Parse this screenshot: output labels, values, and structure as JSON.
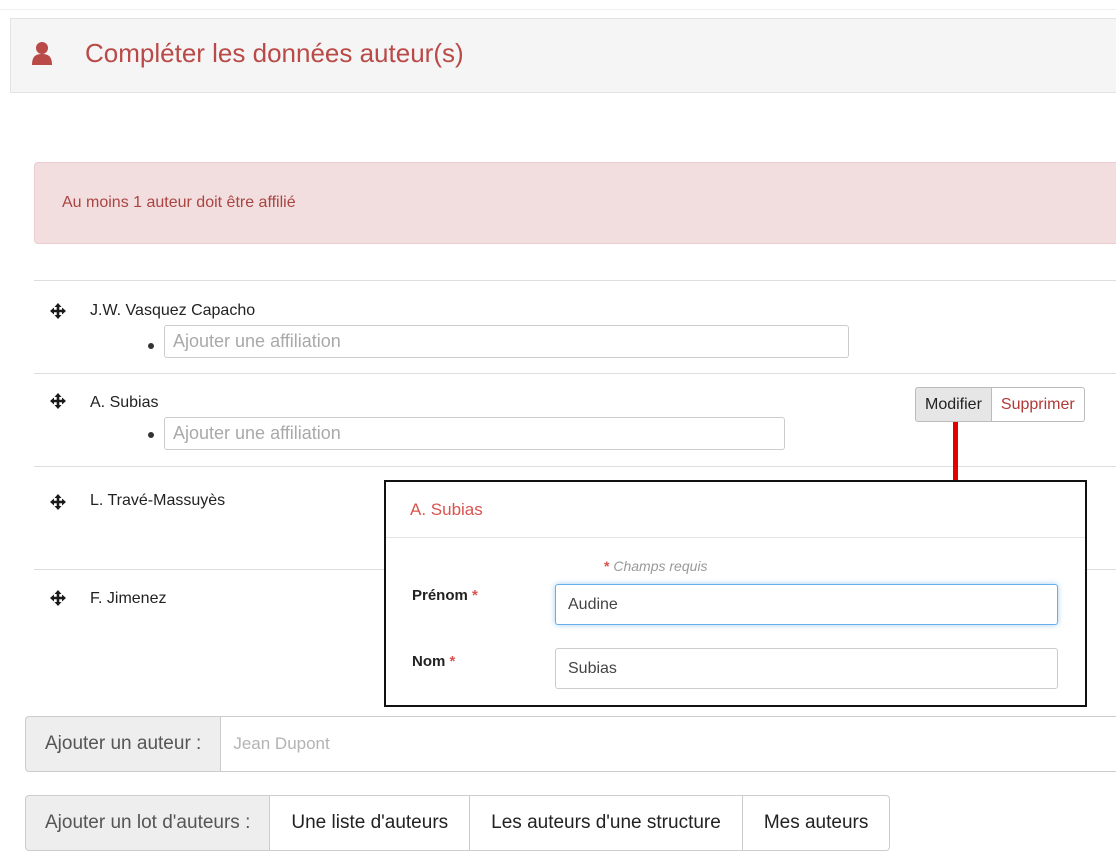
{
  "panel": {
    "title": "Compléter les données auteur(s)",
    "icon": "user-icon"
  },
  "alert": {
    "message": "Au moins 1 auteur doit être affilié"
  },
  "authors": [
    {
      "name": "J.W. Vasquez Capacho",
      "affiliation_placeholder": "Ajouter une affiliation"
    },
    {
      "name": "A. Subias",
      "affiliation_placeholder": "Ajouter une affiliation"
    },
    {
      "name": "L. Travé-Massuyès"
    },
    {
      "name": "F. Jimenez"
    }
  ],
  "author_actions": {
    "modify_label": "Modifier",
    "delete_label": "Supprimer"
  },
  "edit_modal": {
    "title": "A. Subias",
    "required_marker": "*",
    "required_note": "Champs requis",
    "firstname_label": "Prénom",
    "firstname_value": "Audine",
    "lastname_label": "Nom",
    "lastname_value": "Subias"
  },
  "add_author": {
    "label": "Ajouter un auteur :",
    "placeholder": "Jean Dupont"
  },
  "add_batch": {
    "label": "Ajouter un lot d'auteurs :",
    "options": [
      "Une liste d'auteurs",
      "Les auteurs d'une structure",
      "Mes auteurs"
    ]
  },
  "colors": {
    "accent_red": "#b94a48",
    "alert_bg": "#f2dede",
    "annotation_arrow": "#e60000",
    "focus_blue": "#66afe9"
  }
}
